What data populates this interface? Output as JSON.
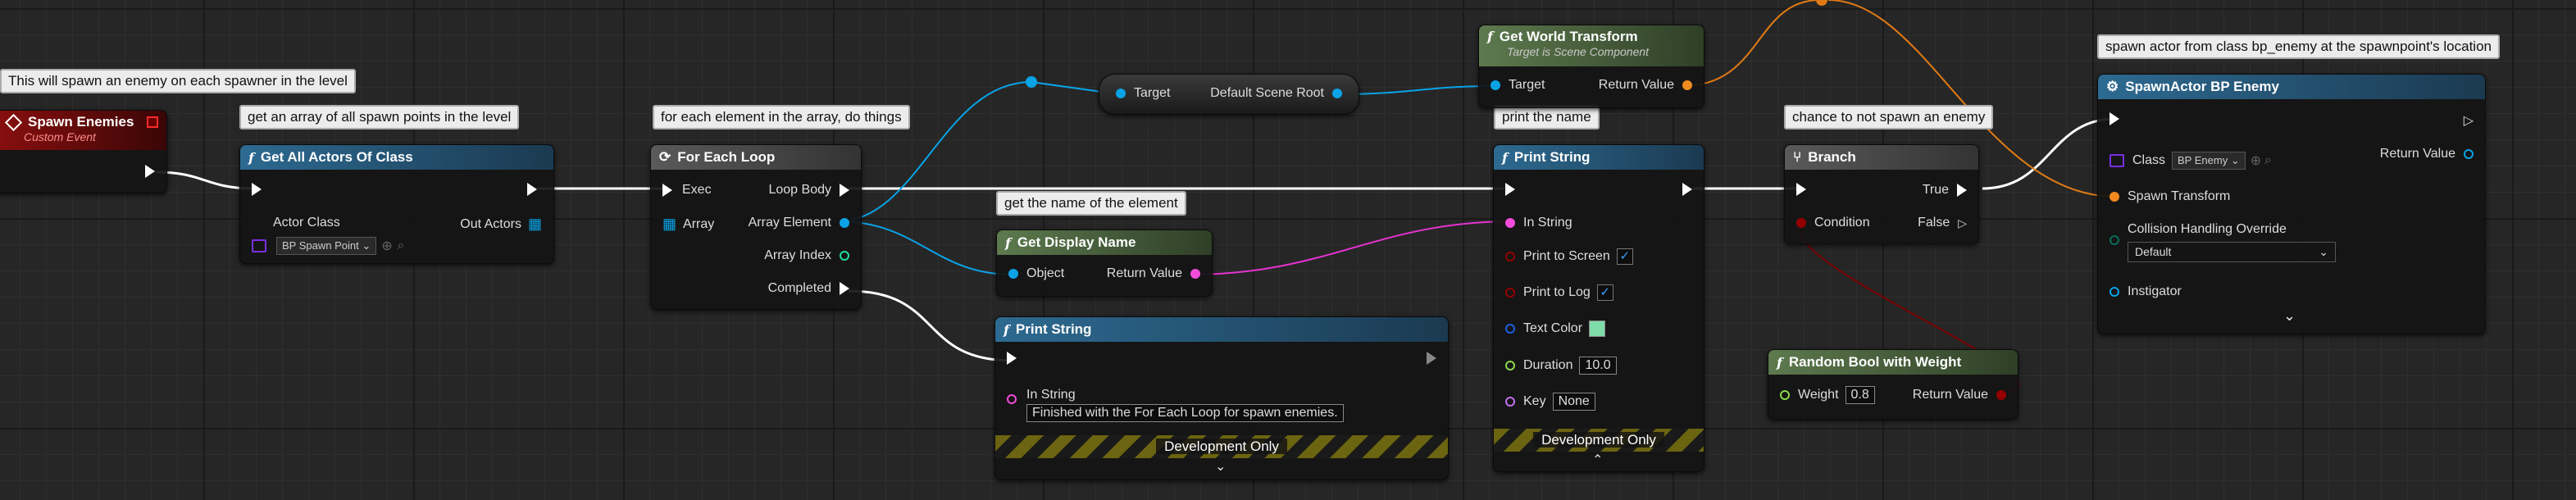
{
  "comments": {
    "spawn_events": "This will spawn an enemy on each spawner in the level",
    "get_all": "get an array of all spawn points in the level",
    "for_each": "for each element in the array, do things",
    "display_name": "get the name of the element",
    "print_name": "print the name",
    "chance": "chance to not spawn an enemy",
    "spawn_actor": "spawn actor from class bp_enemy at the spawnpoint's location"
  },
  "nodes": {
    "spawn_enemies": {
      "title": "Spawn Enemies",
      "subtitle": "Custom Event"
    },
    "get_all_actors": {
      "title": "Get All Actors Of Class",
      "actor_class_label": "Actor Class",
      "actor_class_value": "BP Spawn Point",
      "out_actors": "Out Actors"
    },
    "for_each_loop": {
      "title": "For Each Loop",
      "exec": "Exec",
      "array": "Array",
      "loop_body": "Loop Body",
      "array_element": "Array Element",
      "array_index": "Array Index",
      "completed": "Completed"
    },
    "get_scene_root": {
      "target": "Target",
      "default_scene_root": "Default Scene Root"
    },
    "get_world_transform": {
      "title": "Get World Transform",
      "subtitle": "Target is Scene Component",
      "target": "Target",
      "return_value": "Return Value"
    },
    "get_display_name": {
      "title": "Get Display Name",
      "object": "Object",
      "return_value": "Return Value"
    },
    "print_string_1": {
      "title": "Print String",
      "in_string": "In String",
      "in_string_value": "Finished with the For Each Loop for spawn enemies.",
      "dev_only": "Development Only"
    },
    "print_string_2": {
      "title": "Print String",
      "in_string": "In String",
      "print_to_screen": "Print to Screen",
      "print_to_log": "Print to Log",
      "text_color": "Text Color",
      "duration": "Duration",
      "duration_value": "10.0",
      "key": "Key",
      "key_value": "None",
      "dev_only": "Development Only"
    },
    "branch": {
      "title": "Branch",
      "condition": "Condition",
      "true_label": "True",
      "false_label": "False"
    },
    "random_bool": {
      "title": "Random Bool with Weight",
      "weight": "Weight",
      "weight_value": "0.8",
      "return_value": "Return Value"
    },
    "spawn_actor": {
      "title": "SpawnActor BP Enemy",
      "class_label": "Class",
      "class_value": "BP Enemy",
      "return_value": "Return Value",
      "spawn_transform": "Spawn Transform",
      "collision": "Collision Handling Override",
      "collision_value": "Default",
      "instigator": "Instigator"
    }
  },
  "colors": {
    "exec": "#ffffff",
    "object": "#00a8f4",
    "string": "#f24cdb",
    "transform": "#f28b1f",
    "bool": "#950000",
    "int": "#20dda0",
    "float": "#8cd94a",
    "class": "#6a1fd1",
    "color": "#1f5fe0"
  }
}
